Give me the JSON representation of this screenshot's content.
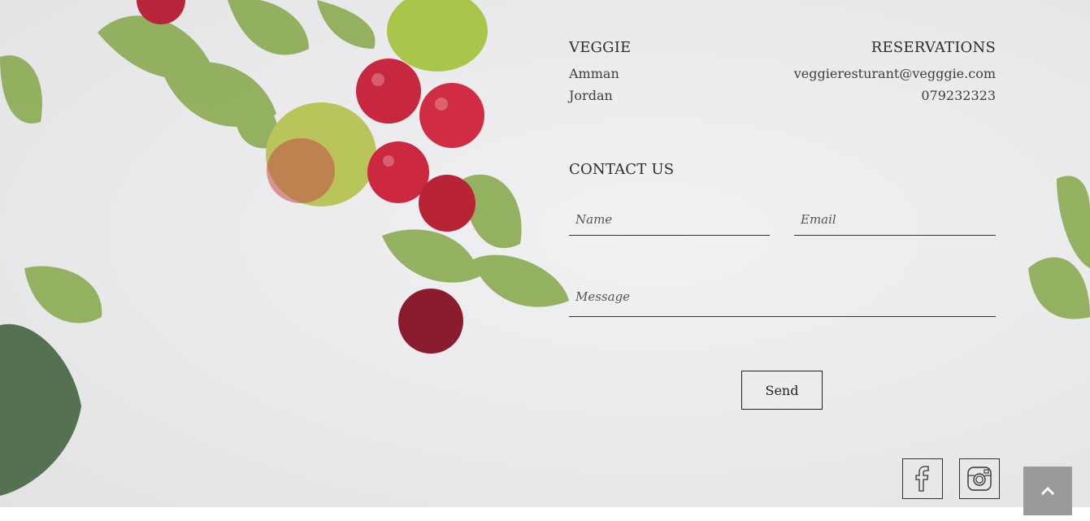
{
  "brand": {
    "title": "VEGGIE",
    "address": [
      "Amman",
      "Jordan"
    ]
  },
  "reservations": {
    "title": "RESERVATIONS",
    "email": "veggieresturant@vegggie.com",
    "phone": "079232323"
  },
  "contact": {
    "title": "CONTACT US",
    "name_placeholder": "Name",
    "email_placeholder": "Email",
    "message_placeholder": "Message",
    "send_label": "Send"
  },
  "social": {
    "facebook_icon": "facebook-icon",
    "instagram_icon": "instagram-icon"
  },
  "back_to_top_icon": "chevron-up-icon",
  "colors": {
    "background": "#ecebec",
    "text": "#333333",
    "back_to_top": "#9a9a9a"
  }
}
